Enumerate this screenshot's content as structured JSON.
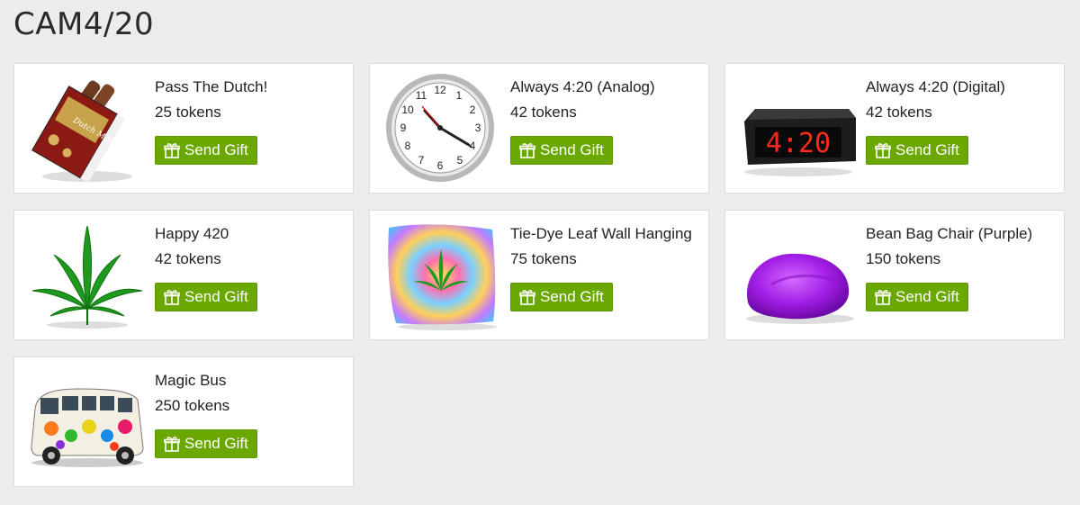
{
  "page": {
    "title": "CAM4/20"
  },
  "button_color": "#6aa800",
  "gifts": [
    {
      "name": "Pass The Dutch!",
      "price": "25 tokens",
      "button": "Send Gift",
      "icon": "cigar-box-icon"
    },
    {
      "name": "Always 4:20 (Analog)",
      "price": "42 tokens",
      "button": "Send Gift",
      "icon": "analog-clock-icon"
    },
    {
      "name": "Always 4:20 (Digital)",
      "price": "42 tokens",
      "button": "Send Gift",
      "icon": "digital-alarm-clock-icon"
    },
    {
      "name": "Happy 420",
      "price": "42 tokens",
      "button": "Send Gift",
      "icon": "leaf-icon"
    },
    {
      "name": "Tie-Dye Leaf Wall Hanging",
      "price": "75 tokens",
      "button": "Send Gift",
      "icon": "tie-dye-tapestry-icon"
    },
    {
      "name": "Bean Bag Chair (Purple)",
      "price": "150 tokens",
      "button": "Send Gift",
      "icon": "bean-bag-icon"
    },
    {
      "name": "Magic Bus",
      "price": "250 tokens",
      "button": "Send Gift",
      "icon": "hippie-van-icon"
    }
  ],
  "images": {
    "cigar_box_brand": "Dutch Masters",
    "digital_clock_time": "4:20"
  }
}
